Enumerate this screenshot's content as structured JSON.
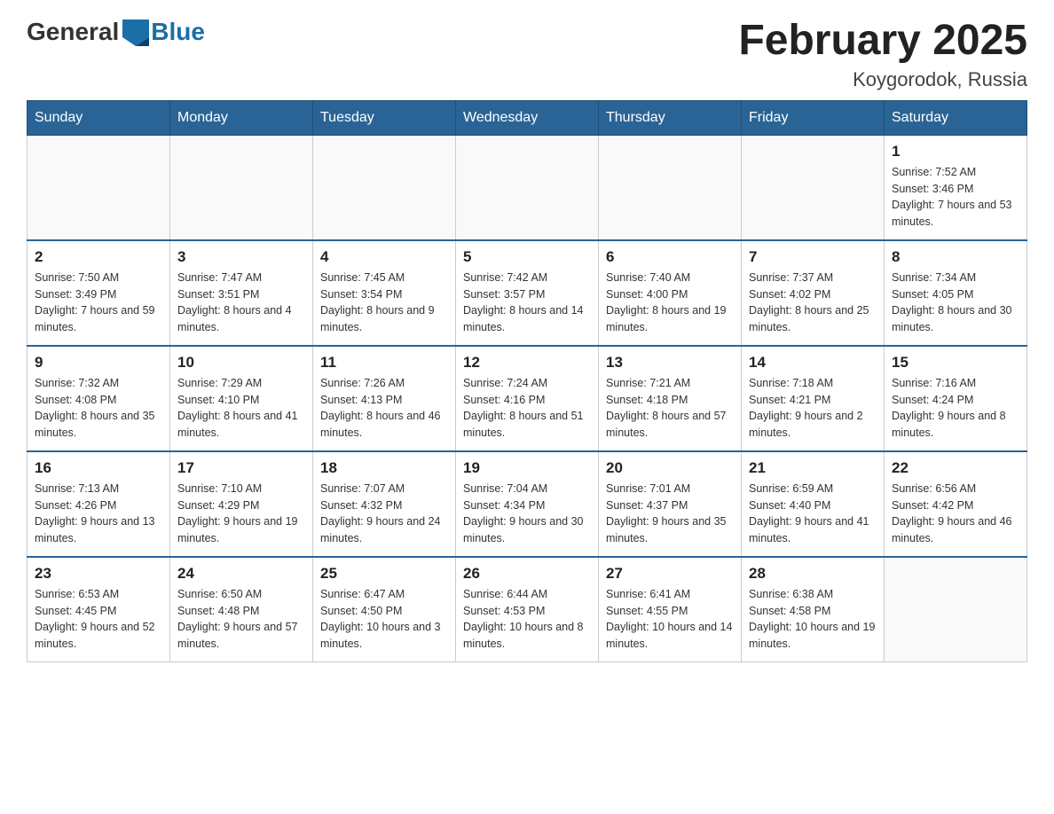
{
  "logo": {
    "general": "General",
    "blue": "Blue"
  },
  "header": {
    "month_year": "February 2025",
    "location": "Koygorodok, Russia"
  },
  "days_of_week": [
    "Sunday",
    "Monday",
    "Tuesday",
    "Wednesday",
    "Thursday",
    "Friday",
    "Saturday"
  ],
  "weeks": [
    [
      {
        "day": "",
        "info": ""
      },
      {
        "day": "",
        "info": ""
      },
      {
        "day": "",
        "info": ""
      },
      {
        "day": "",
        "info": ""
      },
      {
        "day": "",
        "info": ""
      },
      {
        "day": "",
        "info": ""
      },
      {
        "day": "1",
        "info": "Sunrise: 7:52 AM\nSunset: 3:46 PM\nDaylight: 7 hours and 53 minutes."
      }
    ],
    [
      {
        "day": "2",
        "info": "Sunrise: 7:50 AM\nSunset: 3:49 PM\nDaylight: 7 hours and 59 minutes."
      },
      {
        "day": "3",
        "info": "Sunrise: 7:47 AM\nSunset: 3:51 PM\nDaylight: 8 hours and 4 minutes."
      },
      {
        "day": "4",
        "info": "Sunrise: 7:45 AM\nSunset: 3:54 PM\nDaylight: 8 hours and 9 minutes."
      },
      {
        "day": "5",
        "info": "Sunrise: 7:42 AM\nSunset: 3:57 PM\nDaylight: 8 hours and 14 minutes."
      },
      {
        "day": "6",
        "info": "Sunrise: 7:40 AM\nSunset: 4:00 PM\nDaylight: 8 hours and 19 minutes."
      },
      {
        "day": "7",
        "info": "Sunrise: 7:37 AM\nSunset: 4:02 PM\nDaylight: 8 hours and 25 minutes."
      },
      {
        "day": "8",
        "info": "Sunrise: 7:34 AM\nSunset: 4:05 PM\nDaylight: 8 hours and 30 minutes."
      }
    ],
    [
      {
        "day": "9",
        "info": "Sunrise: 7:32 AM\nSunset: 4:08 PM\nDaylight: 8 hours and 35 minutes."
      },
      {
        "day": "10",
        "info": "Sunrise: 7:29 AM\nSunset: 4:10 PM\nDaylight: 8 hours and 41 minutes."
      },
      {
        "day": "11",
        "info": "Sunrise: 7:26 AM\nSunset: 4:13 PM\nDaylight: 8 hours and 46 minutes."
      },
      {
        "day": "12",
        "info": "Sunrise: 7:24 AM\nSunset: 4:16 PM\nDaylight: 8 hours and 51 minutes."
      },
      {
        "day": "13",
        "info": "Sunrise: 7:21 AM\nSunset: 4:18 PM\nDaylight: 8 hours and 57 minutes."
      },
      {
        "day": "14",
        "info": "Sunrise: 7:18 AM\nSunset: 4:21 PM\nDaylight: 9 hours and 2 minutes."
      },
      {
        "day": "15",
        "info": "Sunrise: 7:16 AM\nSunset: 4:24 PM\nDaylight: 9 hours and 8 minutes."
      }
    ],
    [
      {
        "day": "16",
        "info": "Sunrise: 7:13 AM\nSunset: 4:26 PM\nDaylight: 9 hours and 13 minutes."
      },
      {
        "day": "17",
        "info": "Sunrise: 7:10 AM\nSunset: 4:29 PM\nDaylight: 9 hours and 19 minutes."
      },
      {
        "day": "18",
        "info": "Sunrise: 7:07 AM\nSunset: 4:32 PM\nDaylight: 9 hours and 24 minutes."
      },
      {
        "day": "19",
        "info": "Sunrise: 7:04 AM\nSunset: 4:34 PM\nDaylight: 9 hours and 30 minutes."
      },
      {
        "day": "20",
        "info": "Sunrise: 7:01 AM\nSunset: 4:37 PM\nDaylight: 9 hours and 35 minutes."
      },
      {
        "day": "21",
        "info": "Sunrise: 6:59 AM\nSunset: 4:40 PM\nDaylight: 9 hours and 41 minutes."
      },
      {
        "day": "22",
        "info": "Sunrise: 6:56 AM\nSunset: 4:42 PM\nDaylight: 9 hours and 46 minutes."
      }
    ],
    [
      {
        "day": "23",
        "info": "Sunrise: 6:53 AM\nSunset: 4:45 PM\nDaylight: 9 hours and 52 minutes."
      },
      {
        "day": "24",
        "info": "Sunrise: 6:50 AM\nSunset: 4:48 PM\nDaylight: 9 hours and 57 minutes."
      },
      {
        "day": "25",
        "info": "Sunrise: 6:47 AM\nSunset: 4:50 PM\nDaylight: 10 hours and 3 minutes."
      },
      {
        "day": "26",
        "info": "Sunrise: 6:44 AM\nSunset: 4:53 PM\nDaylight: 10 hours and 8 minutes."
      },
      {
        "day": "27",
        "info": "Sunrise: 6:41 AM\nSunset: 4:55 PM\nDaylight: 10 hours and 14 minutes."
      },
      {
        "day": "28",
        "info": "Sunrise: 6:38 AM\nSunset: 4:58 PM\nDaylight: 10 hours and 19 minutes."
      },
      {
        "day": "",
        "info": ""
      }
    ]
  ]
}
